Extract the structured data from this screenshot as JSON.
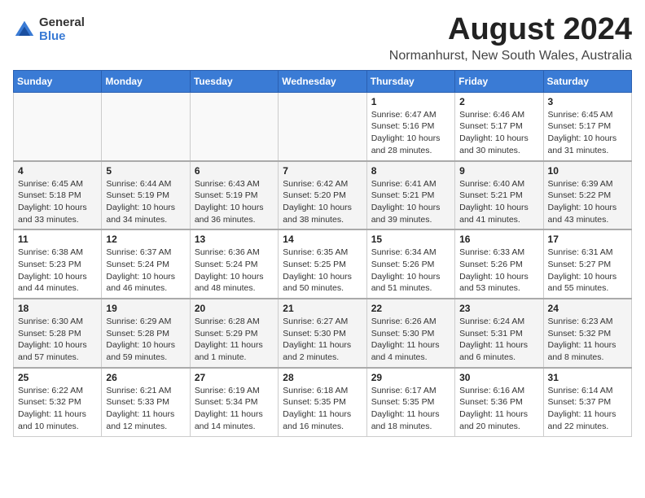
{
  "header": {
    "logo_general": "General",
    "logo_blue": "Blue",
    "main_title": "August 2024",
    "subtitle": "Normanhurst, New South Wales, Australia"
  },
  "calendar": {
    "days_of_week": [
      "Sunday",
      "Monday",
      "Tuesday",
      "Wednesday",
      "Thursday",
      "Friday",
      "Saturday"
    ],
    "weeks": [
      [
        {
          "day": "",
          "info": ""
        },
        {
          "day": "",
          "info": ""
        },
        {
          "day": "",
          "info": ""
        },
        {
          "day": "",
          "info": ""
        },
        {
          "day": "1",
          "sunrise": "6:47 AM",
          "sunset": "5:16 PM",
          "daylight": "10 hours and 28 minutes."
        },
        {
          "day": "2",
          "sunrise": "6:46 AM",
          "sunset": "5:17 PM",
          "daylight": "10 hours and 30 minutes."
        },
        {
          "day": "3",
          "sunrise": "6:45 AM",
          "sunset": "5:17 PM",
          "daylight": "10 hours and 31 minutes."
        }
      ],
      [
        {
          "day": "4",
          "sunrise": "6:45 AM",
          "sunset": "5:18 PM",
          "daylight": "10 hours and 33 minutes."
        },
        {
          "day": "5",
          "sunrise": "6:44 AM",
          "sunset": "5:19 PM",
          "daylight": "10 hours and 34 minutes."
        },
        {
          "day": "6",
          "sunrise": "6:43 AM",
          "sunset": "5:19 PM",
          "daylight": "10 hours and 36 minutes."
        },
        {
          "day": "7",
          "sunrise": "6:42 AM",
          "sunset": "5:20 PM",
          "daylight": "10 hours and 38 minutes."
        },
        {
          "day": "8",
          "sunrise": "6:41 AM",
          "sunset": "5:21 PM",
          "daylight": "10 hours and 39 minutes."
        },
        {
          "day": "9",
          "sunrise": "6:40 AM",
          "sunset": "5:21 PM",
          "daylight": "10 hours and 41 minutes."
        },
        {
          "day": "10",
          "sunrise": "6:39 AM",
          "sunset": "5:22 PM",
          "daylight": "10 hours and 43 minutes."
        }
      ],
      [
        {
          "day": "11",
          "sunrise": "6:38 AM",
          "sunset": "5:23 PM",
          "daylight": "10 hours and 44 minutes."
        },
        {
          "day": "12",
          "sunrise": "6:37 AM",
          "sunset": "5:24 PM",
          "daylight": "10 hours and 46 minutes."
        },
        {
          "day": "13",
          "sunrise": "6:36 AM",
          "sunset": "5:24 PM",
          "daylight": "10 hours and 48 minutes."
        },
        {
          "day": "14",
          "sunrise": "6:35 AM",
          "sunset": "5:25 PM",
          "daylight": "10 hours and 50 minutes."
        },
        {
          "day": "15",
          "sunrise": "6:34 AM",
          "sunset": "5:26 PM",
          "daylight": "10 hours and 51 minutes."
        },
        {
          "day": "16",
          "sunrise": "6:33 AM",
          "sunset": "5:26 PM",
          "daylight": "10 hours and 53 minutes."
        },
        {
          "day": "17",
          "sunrise": "6:31 AM",
          "sunset": "5:27 PM",
          "daylight": "10 hours and 55 minutes."
        }
      ],
      [
        {
          "day": "18",
          "sunrise": "6:30 AM",
          "sunset": "5:28 PM",
          "daylight": "10 hours and 57 minutes."
        },
        {
          "day": "19",
          "sunrise": "6:29 AM",
          "sunset": "5:28 PM",
          "daylight": "10 hours and 59 minutes."
        },
        {
          "day": "20",
          "sunrise": "6:28 AM",
          "sunset": "5:29 PM",
          "daylight": "11 hours and 1 minute."
        },
        {
          "day": "21",
          "sunrise": "6:27 AM",
          "sunset": "5:30 PM",
          "daylight": "11 hours and 2 minutes."
        },
        {
          "day": "22",
          "sunrise": "6:26 AM",
          "sunset": "5:30 PM",
          "daylight": "11 hours and 4 minutes."
        },
        {
          "day": "23",
          "sunrise": "6:24 AM",
          "sunset": "5:31 PM",
          "daylight": "11 hours and 6 minutes."
        },
        {
          "day": "24",
          "sunrise": "6:23 AM",
          "sunset": "5:32 PM",
          "daylight": "11 hours and 8 minutes."
        }
      ],
      [
        {
          "day": "25",
          "sunrise": "6:22 AM",
          "sunset": "5:32 PM",
          "daylight": "11 hours and 10 minutes."
        },
        {
          "day": "26",
          "sunrise": "6:21 AM",
          "sunset": "5:33 PM",
          "daylight": "11 hours and 12 minutes."
        },
        {
          "day": "27",
          "sunrise": "6:19 AM",
          "sunset": "5:34 PM",
          "daylight": "11 hours and 14 minutes."
        },
        {
          "day": "28",
          "sunrise": "6:18 AM",
          "sunset": "5:35 PM",
          "daylight": "11 hours and 16 minutes."
        },
        {
          "day": "29",
          "sunrise": "6:17 AM",
          "sunset": "5:35 PM",
          "daylight": "11 hours and 18 minutes."
        },
        {
          "day": "30",
          "sunrise": "6:16 AM",
          "sunset": "5:36 PM",
          "daylight": "11 hours and 20 minutes."
        },
        {
          "day": "31",
          "sunrise": "6:14 AM",
          "sunset": "5:37 PM",
          "daylight": "11 hours and 22 minutes."
        }
      ]
    ]
  }
}
